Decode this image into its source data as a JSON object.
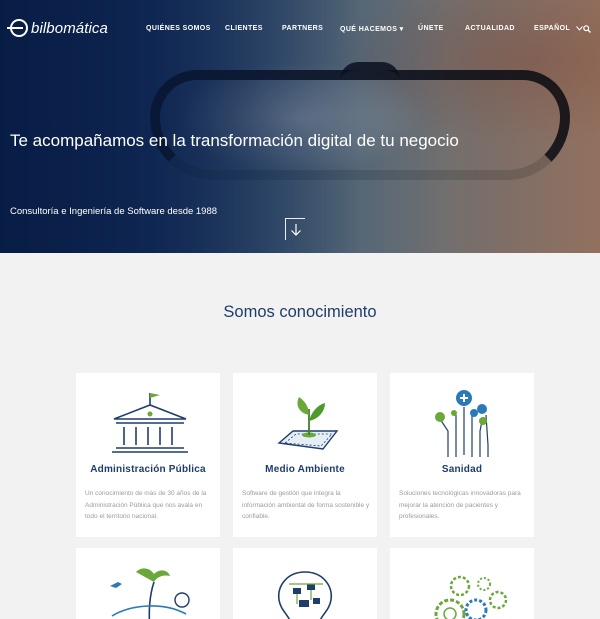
{
  "header": {
    "logo_text": "bilbomática",
    "nav": [
      {
        "label": "QUIÉNES SOMOS"
      },
      {
        "label": "CLIENTES"
      },
      {
        "label": "PARTNERS"
      },
      {
        "label": "QUÉ HACEMOS"
      },
      {
        "label": "ÚNETE"
      },
      {
        "label": "ACTUALIDAD"
      },
      {
        "label": "ESPAÑOL"
      }
    ],
    "dropdown_caret": "▾"
  },
  "hero": {
    "title": "Te acompañamos en la transformación digital de tu negocio",
    "subtitle": "Consultoría e Ingeniería de Software desde 1988"
  },
  "section": {
    "title": "Somos conocimiento"
  },
  "cards": [
    {
      "title": "Administración Pública",
      "description": "Un conocimiento de más de 30 años de la Administración Pública que nos avala en todo el territorio nacional.",
      "icon": "government-building-icon"
    },
    {
      "title": "Medio Ambiente",
      "description": "Software de gestión que integra la información ambiental de forma sostenible y confiable.",
      "icon": "plant-tablet-icon"
    },
    {
      "title": "Sanidad",
      "description": "Soluciones tecnológicas innovadoras para mejorar la atención de pacientes y profesionales.",
      "icon": "health-circuit-icon"
    },
    {
      "title": "",
      "description": "",
      "icon": "tourism-island-icon"
    },
    {
      "title": "",
      "description": "",
      "icon": "lightbulb-circuit-icon"
    },
    {
      "title": "",
      "description": "",
      "icon": "gears-icon"
    }
  ],
  "colors": {
    "primary": "#1e3d6b",
    "accent_green": "#6aa83a",
    "accent_blue": "#2a7ab8",
    "background": "#f2f2f2"
  }
}
